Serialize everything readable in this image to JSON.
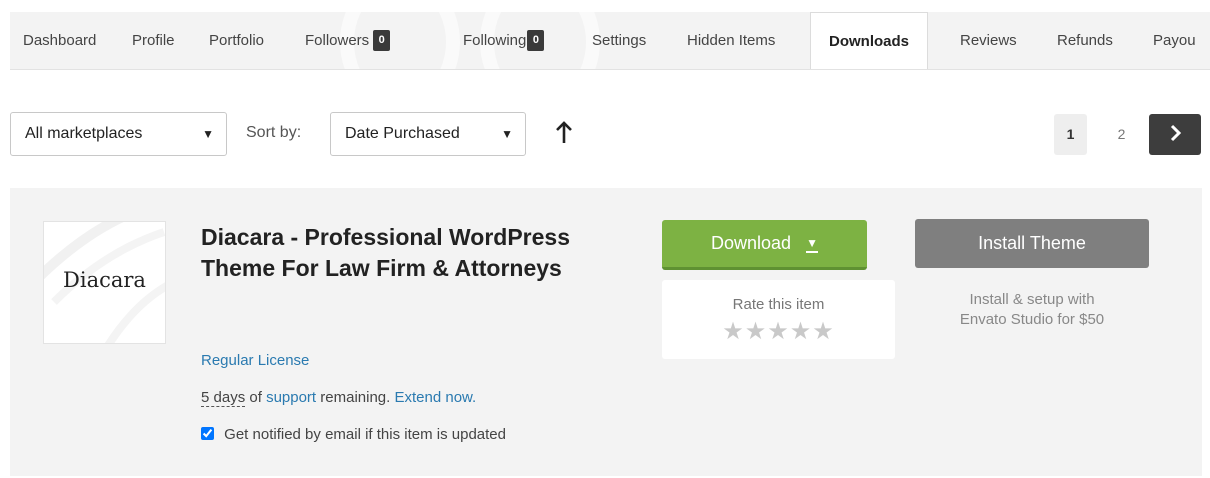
{
  "tabs": [
    {
      "label": "Dashboard"
    },
    {
      "label": "Profile"
    },
    {
      "label": "Portfolio"
    },
    {
      "label": "Followers",
      "count": "0"
    },
    {
      "label": "Following",
      "count": "0"
    },
    {
      "label": "Settings"
    },
    {
      "label": "Hidden Items"
    },
    {
      "label": "Downloads",
      "active": true
    },
    {
      "label": "Reviews"
    },
    {
      "label": "Refunds"
    },
    {
      "label": "Payou"
    }
  ],
  "filters": {
    "marketplace": "All marketplaces",
    "sort_label": "Sort by:",
    "sort_value": "Date Purchased",
    "sort_direction_icon": "arrow-up-icon"
  },
  "pagination": {
    "page1": "1",
    "page2": "2",
    "next_icon": "chevron-right-icon"
  },
  "item": {
    "thumb_logo": "Diacara",
    "title": "Diacara - Professional WordPress Theme For Law Firm & Attorneys",
    "license": "Regular License",
    "support": {
      "days": "5 days",
      "of": "of",
      "link": "support",
      "remaining": "remaining.",
      "extend": "Extend now."
    },
    "notify_label": "Get notified by email if this item is updated",
    "notify_checked": true,
    "download_label": "Download",
    "rate_label": "Rate this item",
    "rating_stars": 5,
    "rating_value": 0,
    "install_label": "Install Theme",
    "install_note_line1": "Install & setup with",
    "install_note_line2": "Envato Studio for $50"
  },
  "colors": {
    "download_green": "#7db243",
    "install_grey": "#7f7f7f",
    "link_blue": "#2a7ab0",
    "next_button": "#3d3d3d"
  }
}
